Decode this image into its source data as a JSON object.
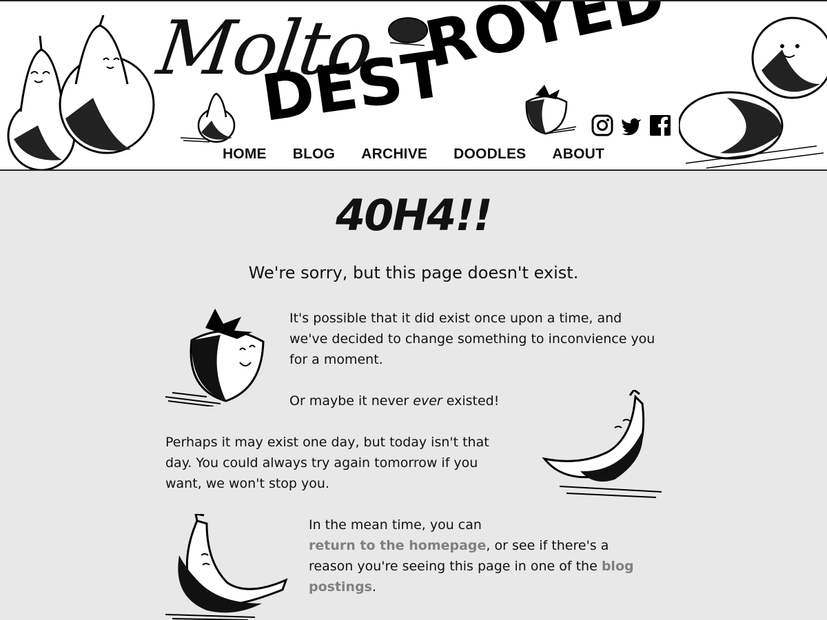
{
  "header": {
    "logo_script": "Molto",
    "logo_block_part1": "DEST",
    "logo_block_part2": "ROYED",
    "social": [
      {
        "icon": "instagram-icon"
      },
      {
        "icon": "twitter-icon"
      },
      {
        "icon": "facebook-icon"
      }
    ],
    "nav": [
      "HOME",
      "BLOG",
      "ARCHIVE",
      "DOODLES",
      "ABOUT"
    ]
  },
  "main": {
    "title": "40H4!!",
    "subtitle": "We're sorry, but this page doesn't exist.",
    "p1": "It's possible that it did exist once upon a time, and we've decided to change something to inconvience you for a moment.",
    "p2_before": "Or maybe it never ",
    "p2_em": "ever",
    "p2_after": " existed!",
    "p3": "Perhaps it may exist one day, but today isn't that day. You could always try again tomorrow if you want, we won't stop you.",
    "p4_before": "In the mean time, you can",
    "p4_link1": "return to the homepage",
    "p4_middle": ", or see if there's a reason you're seeing this page in one of the ",
    "p4_link2": "blog postings",
    "p4_after": "."
  },
  "colors": {
    "page_bg": "#e8e8e8",
    "header_bg": "#ffffff",
    "link": "#808080",
    "text": "#111111"
  }
}
